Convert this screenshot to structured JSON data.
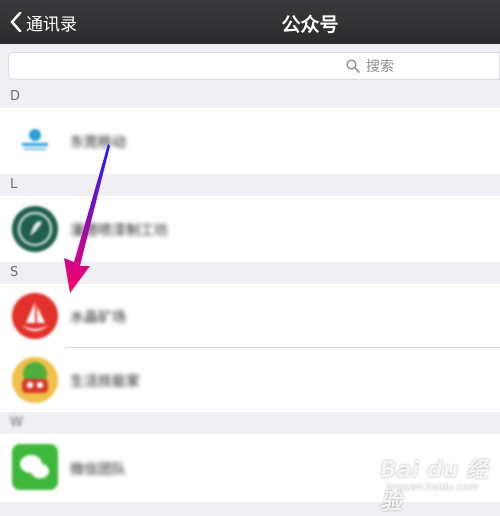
{
  "navbar": {
    "back_label": "通讯录",
    "title": "公众号"
  },
  "search": {
    "placeholder": "搜索"
  },
  "sections": [
    {
      "letter": "D"
    },
    {
      "letter": "L"
    },
    {
      "letter": "S"
    },
    {
      "letter": "W"
    }
  ],
  "accounts": [
    {
      "name": "东莞移动",
      "section": "D"
    },
    {
      "name": "漫德喷漆制工坊",
      "section": "L"
    },
    {
      "name": "水晶矿场",
      "section": "S"
    },
    {
      "name": "生活技能家",
      "section": "S"
    },
    {
      "name": "微信团队",
      "section": "W"
    }
  ],
  "watermark": {
    "main": "Bai du 经验",
    "sub": "jingyan.baidu.com"
  },
  "colors": {
    "navbar": "#2f2f31",
    "background": "#efeff4",
    "arrow_start": "#1a1aff",
    "arrow_end": "#ff0066"
  }
}
